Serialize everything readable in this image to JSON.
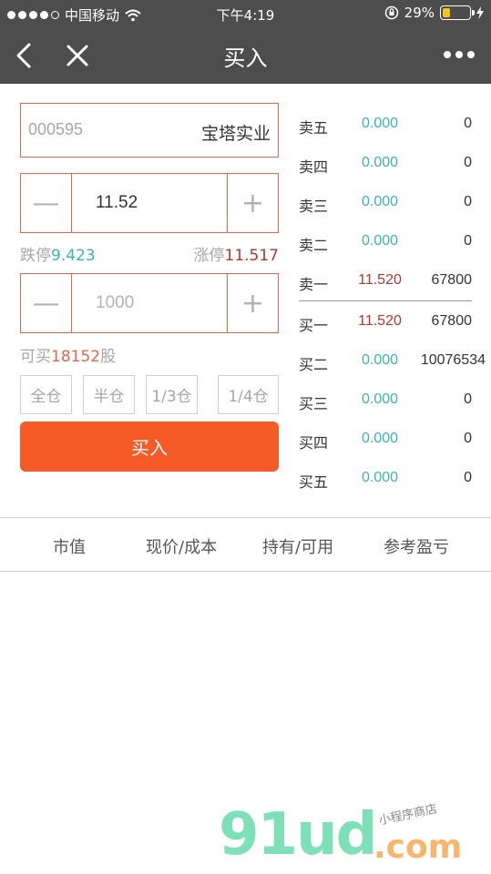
{
  "status_bar": {
    "carrier": "中国移动",
    "time": "下午4:19",
    "battery_percent": "29%",
    "battery_level": 0.29
  },
  "nav": {
    "title": "买入"
  },
  "stock": {
    "code": "000595",
    "name": "宝塔实业"
  },
  "price": {
    "value": "11.52",
    "minus_symbol": "—",
    "plus_symbol": "+"
  },
  "limits": {
    "down_label": "跌停",
    "down_value": "9.423",
    "up_label": "涨停",
    "up_value": "11.517"
  },
  "quantity": {
    "placeholder": "1000",
    "minus_symbol": "—",
    "plus_symbol": "+"
  },
  "can_buy": {
    "prefix": "可买",
    "amount": "18152",
    "suffix": "股"
  },
  "ratios": [
    "全仓",
    "半仓",
    "1/3仓",
    "1/4仓"
  ],
  "buy_button": "买入",
  "order_book": {
    "asks": [
      {
        "label": "卖五",
        "price": "0.000",
        "volume": "0"
      },
      {
        "label": "卖四",
        "price": "0.000",
        "volume": "0"
      },
      {
        "label": "卖三",
        "price": "0.000",
        "volume": "0"
      },
      {
        "label": "卖二",
        "price": "0.000",
        "volume": "0"
      },
      {
        "label": "卖一",
        "price": "11.520",
        "volume": "67800"
      }
    ],
    "bids": [
      {
        "label": "买一",
        "price": "11.520",
        "volume": "67800"
      },
      {
        "label": "买二",
        "price": "0.000",
        "volume": "10076534"
      },
      {
        "label": "买三",
        "price": "0.000",
        "volume": "0"
      },
      {
        "label": "买四",
        "price": "0.000",
        "volume": "0"
      },
      {
        "label": "买五",
        "price": "0.000",
        "volume": "0"
      }
    ]
  },
  "holdings_header": [
    "市值",
    "现价/成本",
    "持有/可用",
    "参考盈亏"
  ],
  "watermark": {
    "logo": "91ud",
    "domain": ".com",
    "tagline": "小程序商店"
  },
  "colors": {
    "nav_bg": "#4d4d4d",
    "accent_orange": "#f55a27",
    "border_orange": "#e8654a",
    "green": "#3bb6a4",
    "red": "#b8342e"
  }
}
